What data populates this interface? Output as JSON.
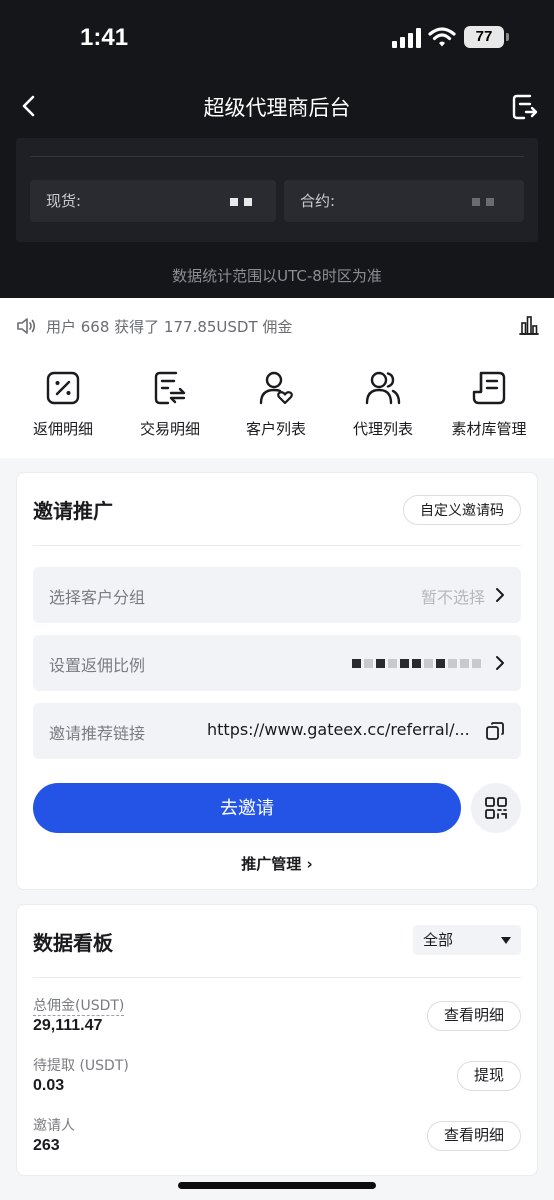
{
  "status_bar": {
    "time": "1:41",
    "battery": "77"
  },
  "nav": {
    "title": "超级代理商后台"
  },
  "summary": {
    "spot_label": "现货:",
    "contract_label": "合约:",
    "range_note": "数据统计范围以UTC-8时区为准"
  },
  "ticker": {
    "text": "用户 668  获得了 177.85USDT 佣金"
  },
  "quick_actions": [
    {
      "label": "返佣明细",
      "icon": "percent-icon"
    },
    {
      "label": "交易明细",
      "icon": "exchange-icon"
    },
    {
      "label": "客户列表",
      "icon": "user-heart-icon"
    },
    {
      "label": "代理列表",
      "icon": "users-icon"
    },
    {
      "label": "素材库管理",
      "icon": "document-icon"
    }
  ],
  "invite": {
    "title": "邀请推广",
    "custom_code_label": "自定义邀请码",
    "group_label": "选择客户分组",
    "group_value": "暂不选择",
    "ratio_label": "设置返佣比例",
    "link_label": "邀请推荐链接",
    "link_value": "https://www.gateex.cc/referral/...",
    "invite_button": "去邀请",
    "manage_label": "推广管理 ›"
  },
  "board": {
    "title": "数据看板",
    "filter_value": "全部",
    "stats": [
      {
        "label": "总佣金(USDT)",
        "value": "29,111.47",
        "action": "查看明细"
      },
      {
        "label": "待提取 (USDT)",
        "value": "0.03",
        "action": "提现"
      },
      {
        "label": "邀请人",
        "value": "263",
        "action": "查看明细"
      }
    ]
  },
  "colors": {
    "primary": "#2354e6",
    "header_bg": "#15161a"
  }
}
